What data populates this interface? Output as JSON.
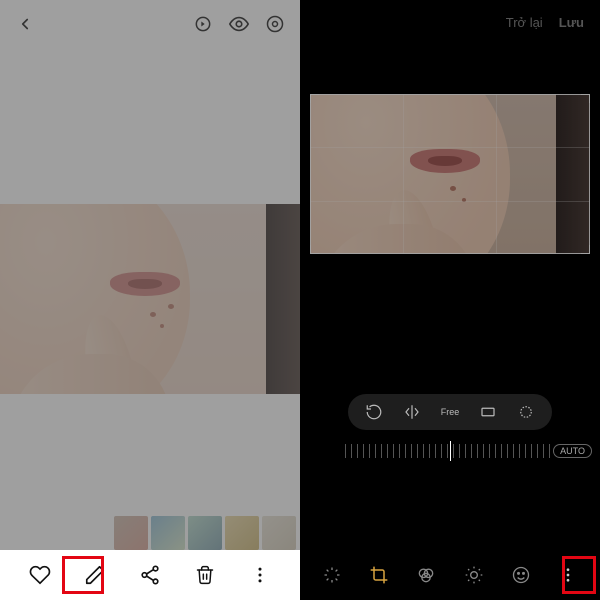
{
  "left": {
    "topbar": {
      "back": "back",
      "icons": [
        "bixby-vision-icon",
        "view-icon",
        "smartview-icon"
      ]
    },
    "bottom": {
      "favorite": "favorite",
      "edit": "edit",
      "share": "share",
      "delete": "delete",
      "more": "more"
    }
  },
  "right": {
    "topbar": {
      "back_label": "Trở lại",
      "save_label": "Lưu"
    },
    "crop_tools": {
      "rotate": "rotate",
      "flip": "flip",
      "free_label": "Free",
      "ratio": "ratio",
      "lasso": "lasso"
    },
    "auto_label": "AUTO",
    "bottom": {
      "auto_enhance": "auto-enhance",
      "crop": "crop",
      "filter": "filter",
      "adjust": "adjust",
      "sticker": "sticker",
      "more": "more"
    }
  },
  "colors": {
    "highlight": "#e30613"
  }
}
